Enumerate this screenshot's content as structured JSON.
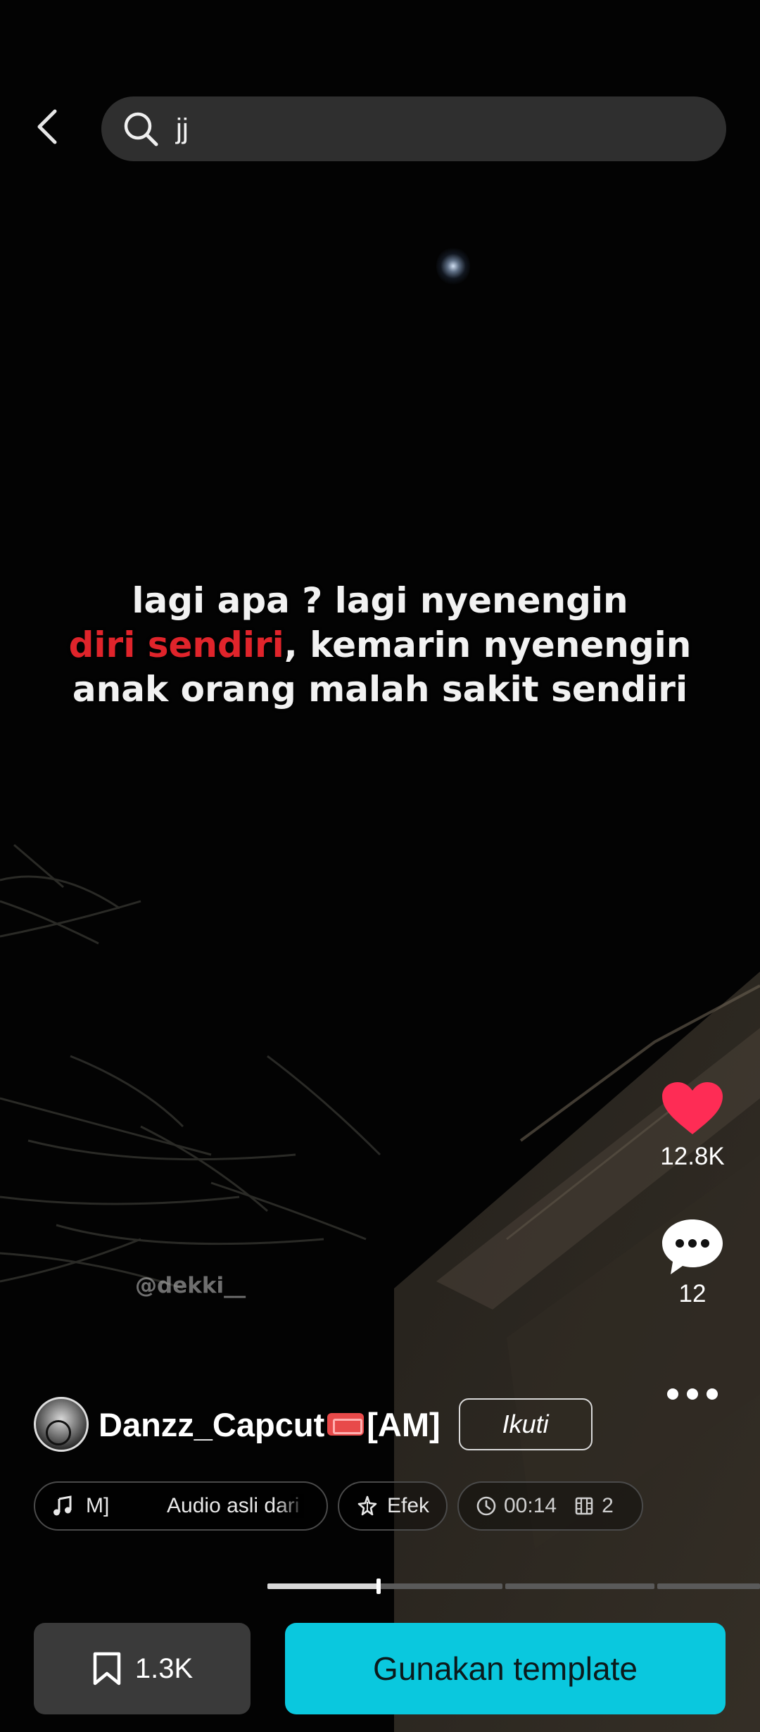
{
  "search": {
    "query": "jj"
  },
  "video": {
    "caption_part1": "lagi apa ? lagi nyenengin",
    "caption_highlight": "diri sendiri",
    "caption_part2": ", kemarin nyenengin",
    "caption_line3": "anak orang malah sakit sendiri",
    "watermark": "@dekki__",
    "highlight_color": "#e0242b"
  },
  "actions": {
    "likes": "12.8K",
    "comments": "12",
    "like_color": "#fe2c55"
  },
  "author": {
    "name": "Danzz_Capcut",
    "name_suffix": "[AM]",
    "follow_label": "Ikuti"
  },
  "chips": {
    "audio_text": "M]          Audio asli dari",
    "effect_label": "Efek",
    "duration": "00:14",
    "clips": "2"
  },
  "progress": {
    "current_segment_fraction": 0.47,
    "segments": 4
  },
  "bottom": {
    "save_count": "1.3K",
    "use_template_label": "Gunakan template",
    "accent": "#0ac8de"
  }
}
